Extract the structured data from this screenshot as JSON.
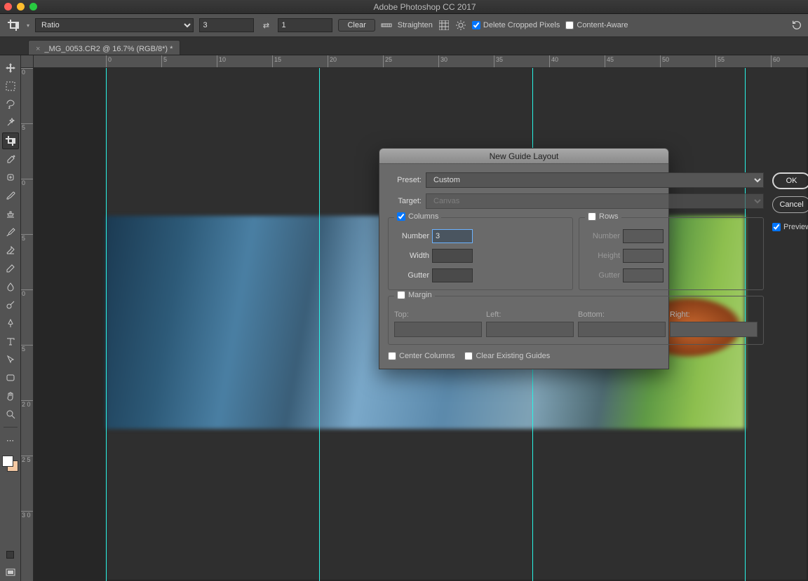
{
  "app": {
    "title": "Adobe Photoshop CC 2017"
  },
  "optionsBar": {
    "ratioLabel": "Ratio",
    "ratioW": "3",
    "ratioH": "1",
    "clear": "Clear",
    "straighten": "Straighten",
    "deleteCropped": "Delete Cropped Pixels",
    "contentAware": "Content-Aware"
  },
  "document": {
    "tabTitle": "_MG_0053.CR2 @ 16.7% (RGB/8*) *"
  },
  "ruler": {
    "hTicks": [
      "0",
      "5",
      "10",
      "15",
      "20",
      "25",
      "30",
      "35",
      "40",
      "45",
      "50",
      "55",
      "60"
    ],
    "vTicks": [
      "0",
      "5",
      "0",
      "5",
      "0",
      "5",
      "2 0",
      "2 5",
      "3 0"
    ]
  },
  "dialog": {
    "title": "New Guide Layout",
    "presetLabel": "Preset:",
    "presetValue": "Custom",
    "targetLabel": "Target:",
    "targetValue": "Canvas",
    "columns": {
      "head": "Columns",
      "checked": true,
      "numberLabel": "Number",
      "numberValue": "3",
      "widthLabel": "Width",
      "widthValue": "",
      "gutterLabel": "Gutter",
      "gutterValue": ""
    },
    "rows": {
      "head": "Rows",
      "checked": false,
      "numberLabel": "Number",
      "heightLabel": "Height",
      "gutterLabel": "Gutter"
    },
    "margin": {
      "head": "Margin",
      "checked": false,
      "top": "Top:",
      "left": "Left:",
      "bottom": "Bottom:",
      "right": "Right:"
    },
    "centerColumns": "Center Columns",
    "clearExisting": "Clear Existing Guides",
    "ok": "OK",
    "cancel": "Cancel",
    "preview": "Preview",
    "previewChecked": true
  }
}
